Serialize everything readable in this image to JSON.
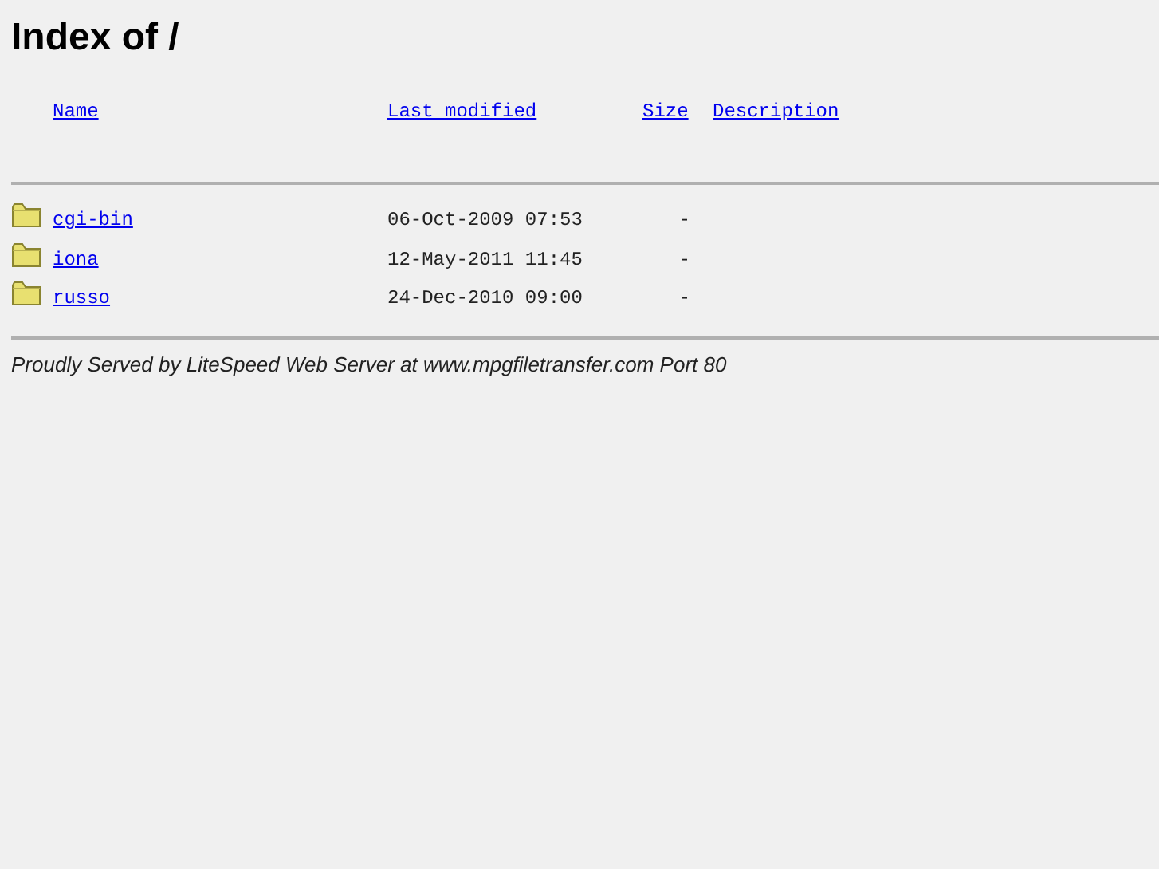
{
  "title": "Index of /",
  "columns": [
    "Name",
    "Last modified",
    "Size",
    "Description"
  ],
  "rows": [
    {
      "name": "cgi-bin",
      "modified": "06-Oct-2009 07:53",
      "size": "-"
    },
    {
      "name": "iona",
      "modified": "12-May-2011 11:45",
      "size": "-"
    },
    {
      "name": "russo",
      "modified": "24-Dec-2010 09:00",
      "size": "-"
    }
  ],
  "footer": "Proudly Served by LiteSpeed Web Server at www.mpgfiletransfer.com Port 80"
}
